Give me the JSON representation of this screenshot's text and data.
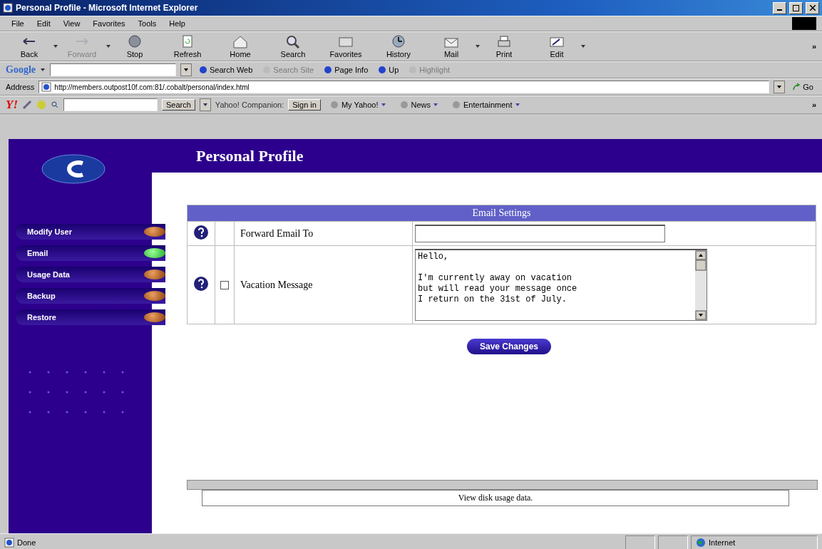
{
  "window": {
    "title": "Personal Profile - Microsoft Internet Explorer"
  },
  "menu": [
    "File",
    "Edit",
    "View",
    "Favorites",
    "Tools",
    "Help"
  ],
  "toolbar": [
    {
      "label": "Back",
      "disabled": false,
      "caret": true
    },
    {
      "label": "Forward",
      "disabled": true,
      "caret": true
    },
    {
      "label": "Stop",
      "disabled": false,
      "caret": false
    },
    {
      "label": "Refresh",
      "disabled": false,
      "caret": false
    },
    {
      "label": "Home",
      "disabled": false,
      "caret": false
    },
    {
      "label": "Search",
      "disabled": false,
      "caret": false
    },
    {
      "label": "Favorites",
      "disabled": false,
      "caret": false
    },
    {
      "label": "History",
      "disabled": false,
      "caret": false
    },
    {
      "label": "Mail",
      "disabled": false,
      "caret": true
    },
    {
      "label": "Print",
      "disabled": false,
      "caret": false
    },
    {
      "label": "Edit",
      "disabled": false,
      "caret": true
    }
  ],
  "toolbar_more": "»",
  "google_bar": {
    "logo": "Google",
    "items": [
      {
        "label": "Search Web",
        "disabled": false
      },
      {
        "label": "Search Site",
        "disabled": true
      },
      {
        "label": "Page Info",
        "disabled": false
      },
      {
        "label": "Up",
        "disabled": false
      },
      {
        "label": "Highlight",
        "disabled": true
      }
    ]
  },
  "address_bar": {
    "label": "Address",
    "url": "http://members.outpost10f.com:81/.cobalt/personal/index.html",
    "go": "Go"
  },
  "yahoo_bar": {
    "logo": "Y!",
    "search_button": "Search",
    "companion": "Yahoo! Companion:",
    "sign_in": "Sign in",
    "links": [
      "My Yahoo!",
      "News",
      "Entertainment"
    ],
    "more": "»"
  },
  "page": {
    "title": "Personal Profile",
    "sidebar": [
      {
        "label": "Modify User",
        "selected": false
      },
      {
        "label": "Email",
        "selected": true
      },
      {
        "label": "Usage Data",
        "selected": false
      },
      {
        "label": "Backup",
        "selected": false
      },
      {
        "label": "Restore",
        "selected": false
      }
    ],
    "table": {
      "heading": "Email Settings",
      "rows": [
        {
          "kind": "input",
          "label": "Forward Email To"
        },
        {
          "kind": "textarea",
          "label": "Vacation Message",
          "checked": false,
          "value": "Hello,\n\nI'm currently away on vacation\nbut will read your message once\nI return on the 31st of July."
        }
      ]
    },
    "save_button": "Save Changes",
    "footer": "View disk usage data."
  },
  "status_bar": {
    "text": "Done",
    "zone": "Internet"
  }
}
